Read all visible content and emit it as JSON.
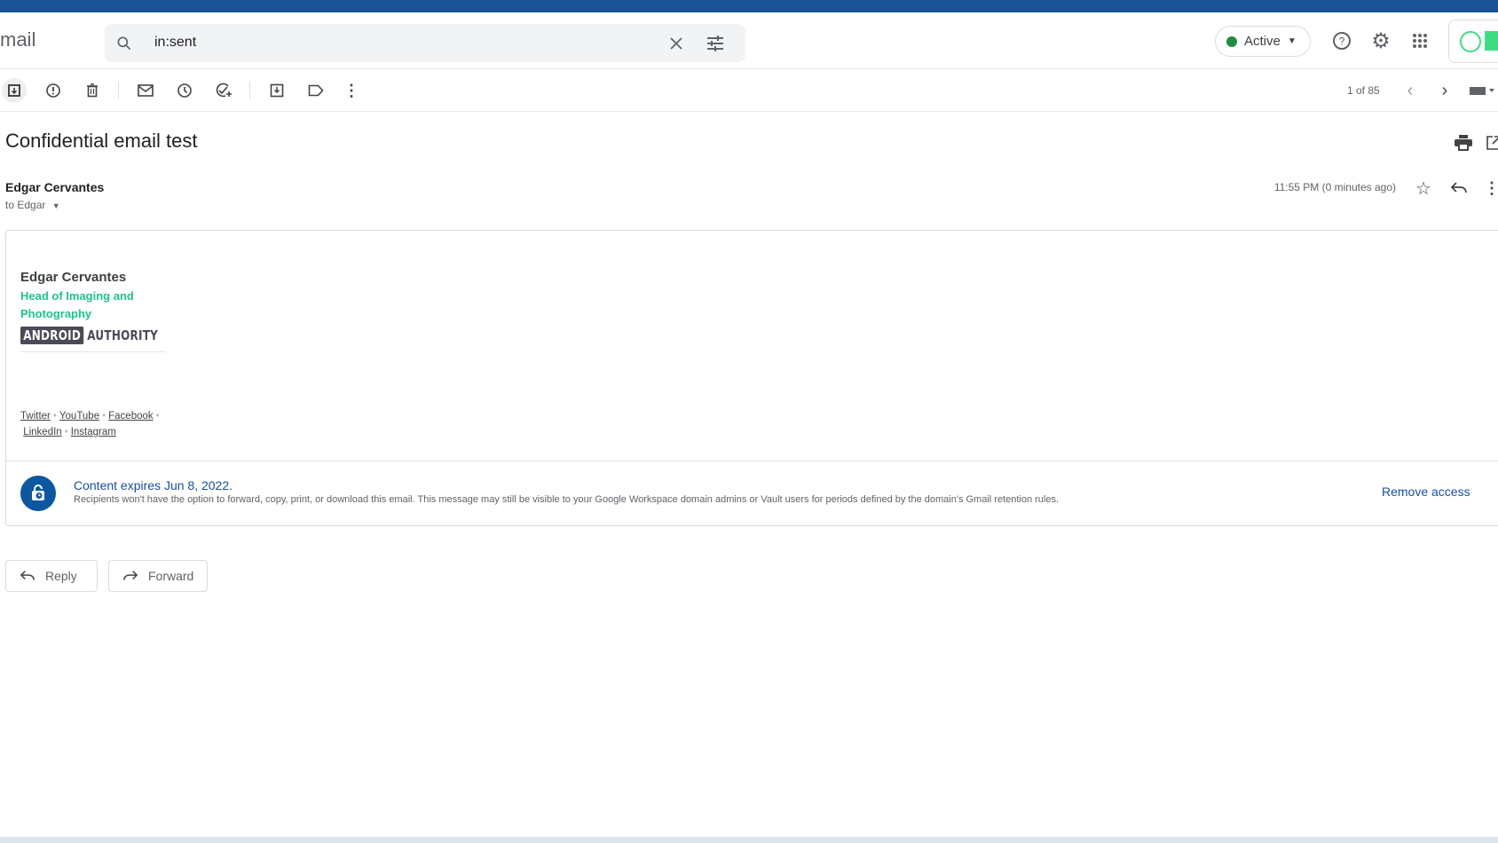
{
  "app": {
    "brand": "mail"
  },
  "search": {
    "query": "in:sent"
  },
  "status": {
    "label": "Active",
    "color": "#1e8e3e"
  },
  "toolbar": {
    "pagination": "1 of 85"
  },
  "email": {
    "subject": "Confidential email test",
    "sender": "Edgar Cervantes",
    "recipient": "to Edgar",
    "time": "11:55 PM (0 minutes ago)",
    "signature": {
      "name": "Edgar Cervantes",
      "title": "Head of Imaging and Photography",
      "logo_left": "ANDROID",
      "logo_right": "AUTHORITY",
      "links": [
        "Twitter",
        "YouTube",
        "Facebook",
        "LinkedIn",
        "Instagram"
      ]
    },
    "confidential": {
      "title": "Content expires Jun 8, 2022.",
      "description": "Recipients won't have the option to forward, copy, print, or download this email. This message may still be visible to your Google Workspace domain admins or Vault users for periods defined by the domain's Gmail retention rules.",
      "remove_label": "Remove access"
    }
  },
  "actions": {
    "reply": "Reply",
    "forward": "Forward"
  },
  "colors": {
    "accent": "#174ea6",
    "sig_green": "#1ec38a",
    "topbar": "#1a5298"
  }
}
